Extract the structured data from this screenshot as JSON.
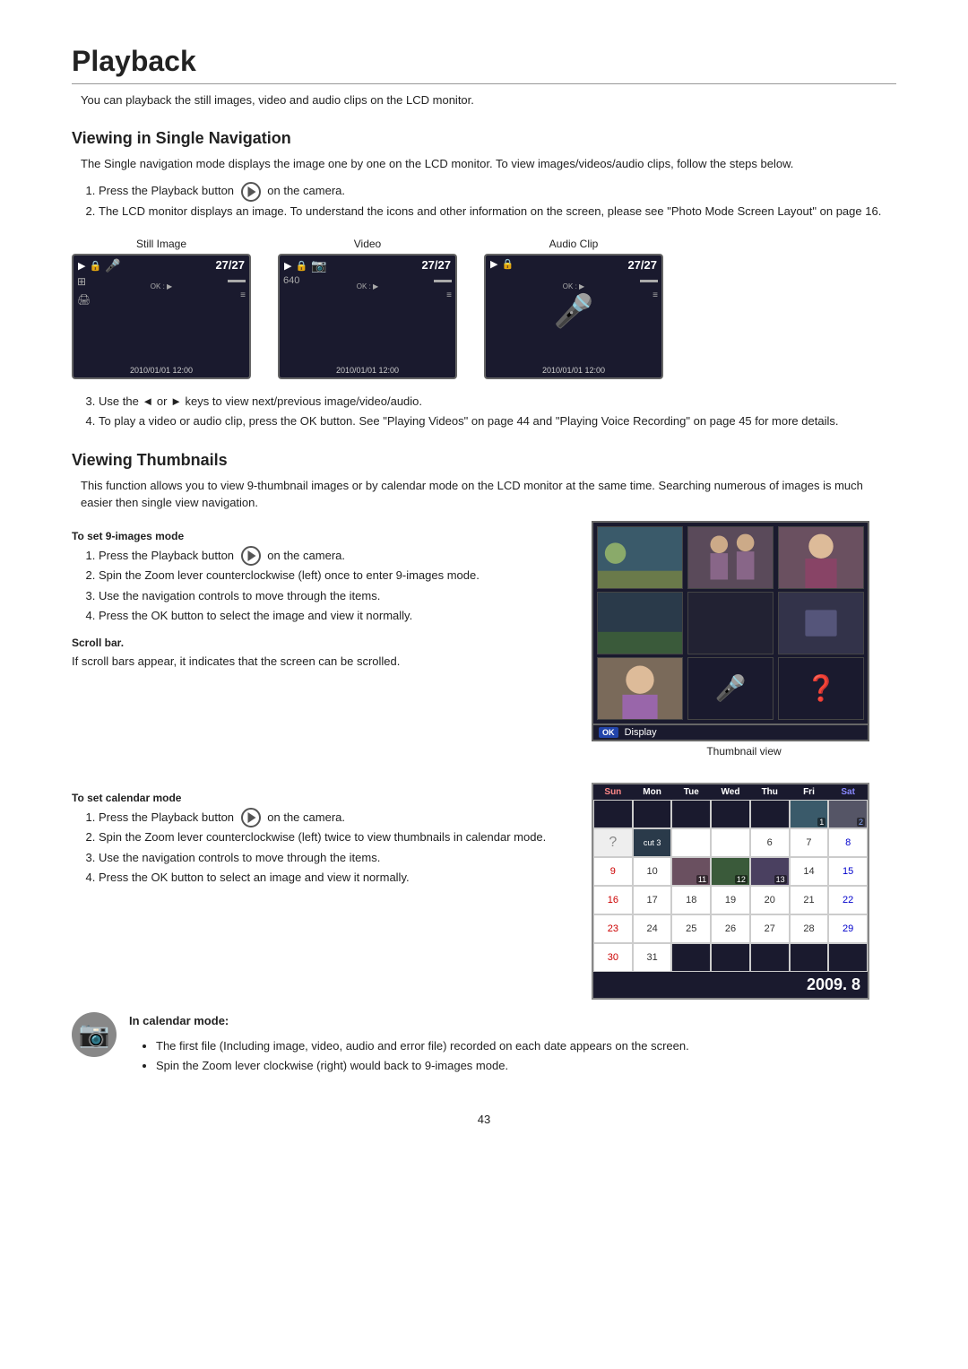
{
  "page": {
    "title": "Playback",
    "page_number": "43",
    "intro": "You can playback the still images, video and audio clips on the LCD monitor."
  },
  "section1": {
    "title": "Viewing in Single Navigation",
    "intro": "The Single navigation mode displays the image one by one on the LCD monitor. To view images/videos/audio clips, follow the steps below.",
    "steps": [
      "Press the Playback button    on the camera.",
      "The LCD monitor displays an image. To understand the icons and other information on the screen, please see \"Photo Mode Screen Layout\" on page 16."
    ],
    "screens": [
      {
        "label": "Still Image",
        "count": "27/27",
        "timestamp": "2010/01/01 12:00",
        "type": "still"
      },
      {
        "label": "Video",
        "count": "27/27",
        "timestamp": "2010/01/01 12:00",
        "type": "video"
      },
      {
        "label": "Audio Clip",
        "count": "27/27",
        "timestamp": "2010/01/01 12:00",
        "type": "audio"
      }
    ],
    "steps2": [
      "Use the ◄ or ► keys to view next/previous image/video/audio.",
      "To play a video or audio clip, press the OK button. See \"Playing Videos\" on page 44 and \"Playing Voice Recording\" on page 45 for more details."
    ]
  },
  "section2": {
    "title": "Viewing Thumbnails",
    "intro": "This function allows you to view 9-thumbnail images or by calendar mode on the LCD monitor at the same time. Searching numerous of images is much easier then single view navigation.",
    "nine_images_label": "To set 9-images mode",
    "nine_steps": [
      "Press the Playback button    on the camera.",
      "Spin the Zoom lever counterclockwise (left) once to enter 9-images mode.",
      "Use the navigation controls to move through the items.",
      "Press the OK button to select the image and view it normally."
    ],
    "scroll_label": "Scroll bar.",
    "scroll_text": "If scroll bars appear, it indicates that the screen can be scrolled.",
    "ok_display": "Display",
    "ok_badge": "OK",
    "thumb_view_label": "Thumbnail view",
    "calendar_label": "To set calendar mode",
    "calendar_steps": [
      "Press the Playback button    on the camera.",
      "Spin the Zoom lever counterclockwise (left) twice to view thumbnails in calendar mode.",
      "Use the navigation controls to move through the items.",
      "Press the OK button to select an image and view it normally."
    ],
    "calendar_header": [
      "Sun",
      "Mon",
      "Tue",
      "Wed",
      "Thu",
      "Fri",
      "Sat"
    ],
    "calendar_rows": [
      [
        "",
        "",
        "",
        "",
        "",
        "",
        ""
      ],
      [
        "?",
        "cut3",
        "",
        "",
        "6",
        "7",
        "8"
      ],
      [
        "9",
        "10",
        "11",
        "12",
        "13",
        "14",
        "15"
      ],
      [
        "16",
        "17",
        "18",
        "19",
        "20",
        "21",
        "22"
      ],
      [
        "23",
        "24",
        "25",
        "26",
        "27",
        "28",
        "29"
      ],
      [
        "30",
        "31",
        "",
        "",
        "",
        "",
        ""
      ]
    ],
    "year_month": "2009. 8",
    "calendar_note_title": "In calendar mode:",
    "calendar_notes": [
      "The first file (Including image, video, audio and error file) recorded on each date appears on the screen.",
      "Spin the Zoom lever clockwise (right) would back to 9-images mode."
    ]
  }
}
